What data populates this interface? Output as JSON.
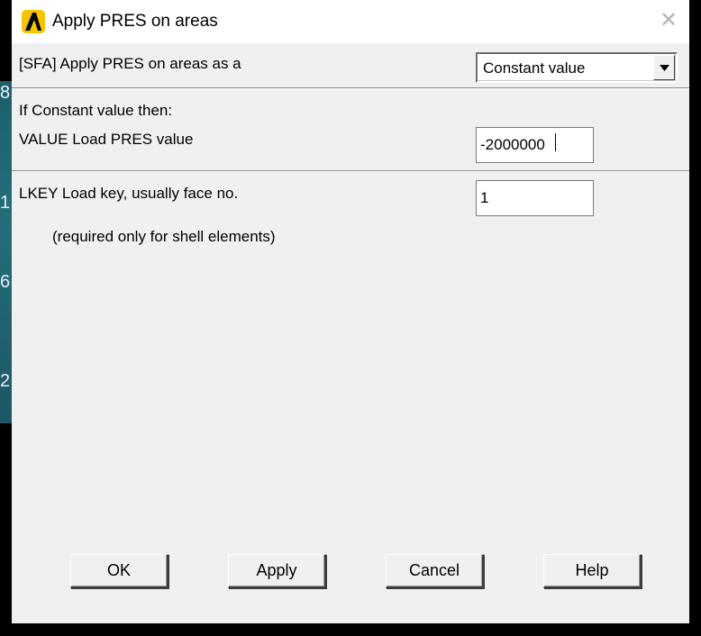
{
  "window": {
    "title": "Apply PRES on areas",
    "close_glyph": "✕"
  },
  "background": {
    "numbers": [
      "8",
      "1",
      "6",
      "2"
    ]
  },
  "form": {
    "apply_as_label": "[SFA] Apply PRES on areas as a",
    "apply_as_value": "Constant value",
    "if_constant_label": "If Constant value then:",
    "value_label": "VALUE  Load PRES value",
    "value_input": "-2000000",
    "lkey_label": "LKEY  Load key, usually face no.",
    "lkey_input": "1",
    "lkey_note": "(required only for shell elements)"
  },
  "buttons": {
    "ok": "OK",
    "apply": "Apply",
    "cancel": "Cancel",
    "help": "Help"
  },
  "colors": {
    "icon_yellow": "#f7c400",
    "dialog_bg": "#f0f0f0"
  }
}
